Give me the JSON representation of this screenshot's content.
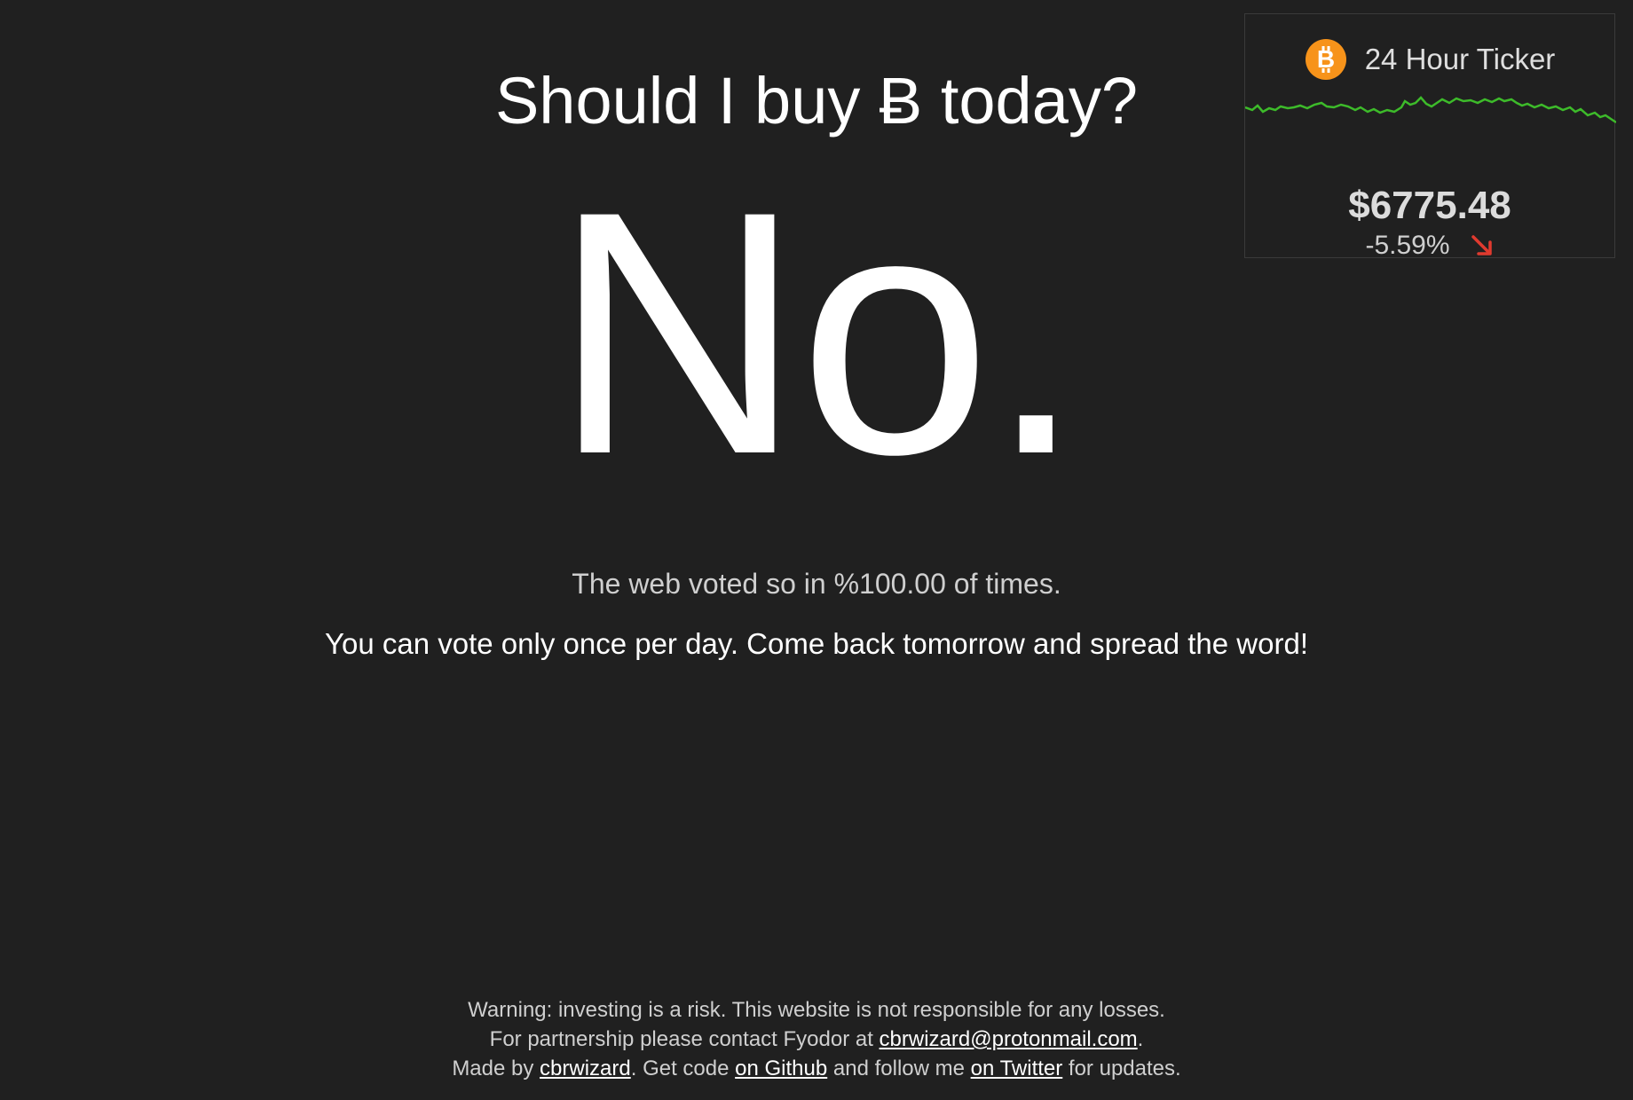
{
  "headline": "Should I buy Ƀ today?",
  "answer": "No.",
  "vote_result": "The web voted so in %100.00 of times.",
  "vote_notice": "You can vote only once per day. Come back tomorrow and spread the word!",
  "ticker": {
    "icon": "bitcoin-logo-icon",
    "title": "24 Hour Ticker",
    "price": "$6775.48",
    "change": "-5.59%",
    "trend_icon": "down-right-arrow-icon",
    "line_color": "#3dbb2a",
    "arrow_color": "#e03a2f",
    "logo_color": "#f7931a"
  },
  "footer": {
    "warning": "Warning: investing is a risk. This website is not responsible for any losses.",
    "partner_prefix": "For partnership please contact Fyodor at ",
    "partner_email": "cbrwizard@protonmail.com",
    "partner_suffix": ".",
    "made_prefix": "Made by ",
    "made_author": "cbrwizard",
    "made_mid1": ". Get code ",
    "made_github": "on Github",
    "made_mid2": " and follow me ",
    "made_twitter": "on Twitter",
    "made_suffix": " for updates."
  }
}
